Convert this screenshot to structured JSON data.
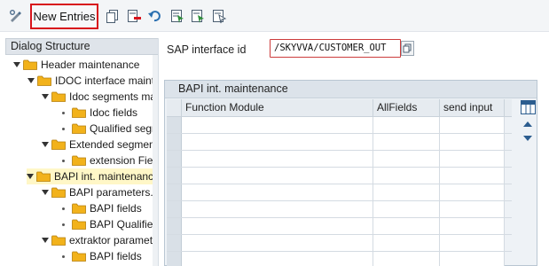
{
  "toolbar": {
    "new_entries_label": "New Entries",
    "icons": [
      "display-change-icon",
      "copy-icon",
      "delete-icon",
      "undo-icon",
      "select-all-icon",
      "select-block-icon",
      "deselect-all-icon"
    ]
  },
  "dialog_structure": {
    "title": "Dialog Structure",
    "items": [
      {
        "label": "Header maintenance",
        "level": 0,
        "expanded": true
      },
      {
        "label": "IDOC interface maint",
        "level": 1,
        "expanded": true
      },
      {
        "label": "Idoc segments ma",
        "level": 2,
        "expanded": true
      },
      {
        "label": "Idoc fields",
        "level": 3,
        "leaf": true
      },
      {
        "label": "Qualified segm",
        "level": 3,
        "leaf": true
      },
      {
        "label": "Extended segmen",
        "level": 2,
        "expanded": true
      },
      {
        "label": "extension Field",
        "level": 3,
        "leaf": true
      },
      {
        "label": "BAPI int. maintenanc",
        "level": 1,
        "expanded": true,
        "selected": true
      },
      {
        "label": "BAPI parameters.",
        "level": 2,
        "expanded": true
      },
      {
        "label": "BAPI fields",
        "level": 3,
        "leaf": true
      },
      {
        "label": "BAPI Qualified",
        "level": 3,
        "leaf": true
      },
      {
        "label": "extraktor paramet",
        "level": 2,
        "expanded": true
      },
      {
        "label": "BAPI fields",
        "level": 3,
        "leaf": true
      }
    ]
  },
  "sap_interface": {
    "label": "SAP interface id",
    "value": "/SKYVVA/CUSTOMER_OUT"
  },
  "bapi_table": {
    "title": "BAPI int. maintenance",
    "columns": [
      "Function Module",
      "AllFields",
      "send input"
    ],
    "row_count": 9
  },
  "colors": {
    "highlight_border": "#d8141c",
    "folder": "#f2b21b",
    "selected_row": "#fff7c7",
    "required_border": "#cc3b3b"
  }
}
